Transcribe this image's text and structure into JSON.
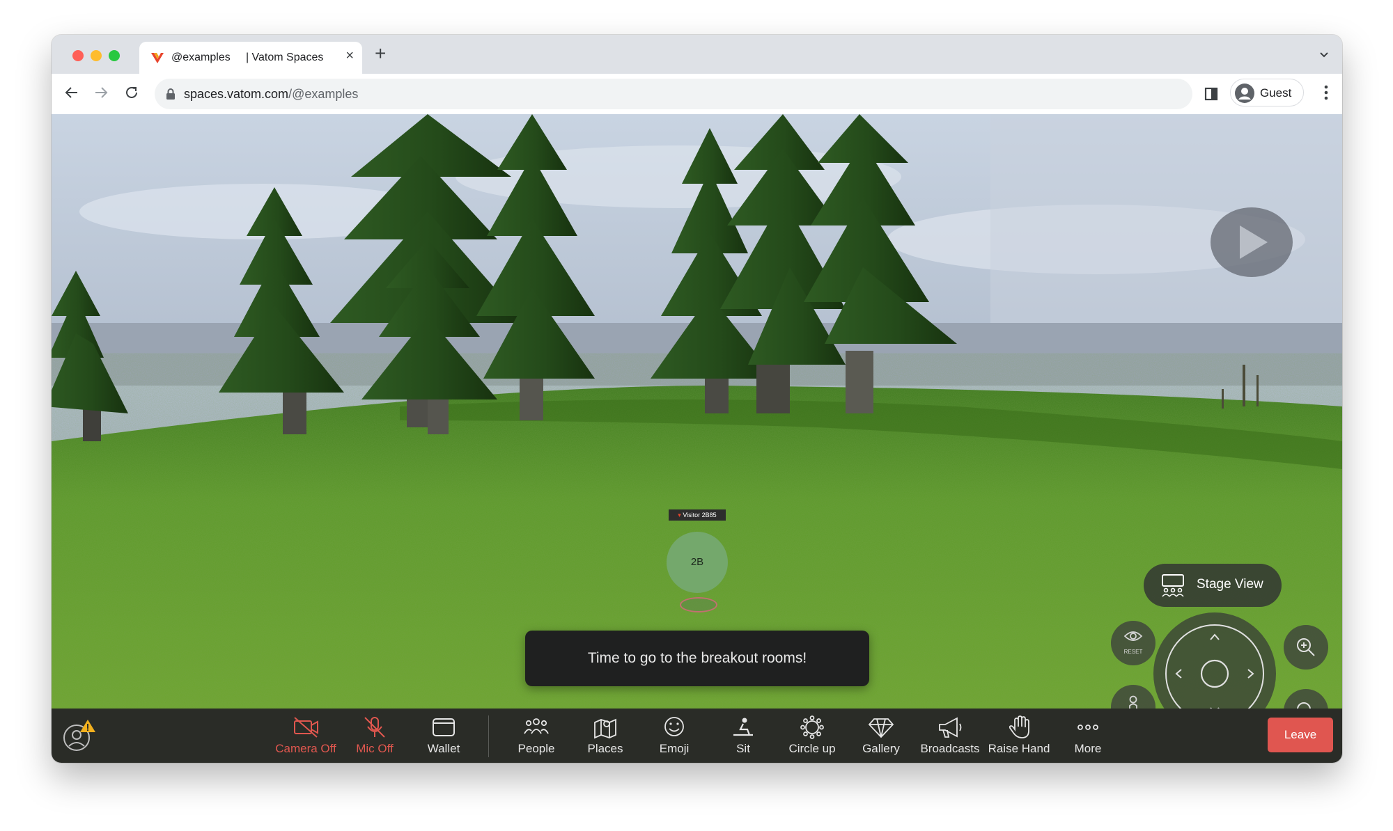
{
  "browser": {
    "tab_title": "@examples     | Vatom Spaces",
    "url_host": "spaces.vatom.com",
    "url_path": "/@examples",
    "profile_label": "Guest",
    "colors": {
      "close": "#ff5f57",
      "minimize": "#febc2e",
      "maximize": "#28c840"
    }
  },
  "scene": {
    "avatar_name": "Visitor 2B85",
    "avatar_initials": "2B",
    "toast": "Time to go to the breakout rooms!",
    "stage_view_label": "Stage View",
    "reset_label": "RESET"
  },
  "bottom_bar": {
    "items": [
      {
        "label": "Camera Off",
        "icon": "camera-off-icon",
        "state": "off"
      },
      {
        "label": "Mic Off",
        "icon": "mic-off-icon",
        "state": "off"
      },
      {
        "label": "Wallet",
        "icon": "wallet-icon"
      },
      {
        "label": "People",
        "icon": "people-icon"
      },
      {
        "label": "Places",
        "icon": "places-icon"
      },
      {
        "label": "Emoji",
        "icon": "emoji-icon"
      },
      {
        "label": "Sit",
        "icon": "sit-icon"
      },
      {
        "label": "Circle up",
        "icon": "circle-up-icon"
      },
      {
        "label": "Gallery",
        "icon": "gallery-icon"
      },
      {
        "label": "Broadcasts",
        "icon": "broadcasts-icon"
      },
      {
        "label": "Raise Hand",
        "icon": "raise-hand-icon"
      },
      {
        "label": "More",
        "icon": "more-icon"
      }
    ],
    "leave_label": "Leave",
    "colors": {
      "off": "#e0574f",
      "leave": "#e05650"
    }
  }
}
